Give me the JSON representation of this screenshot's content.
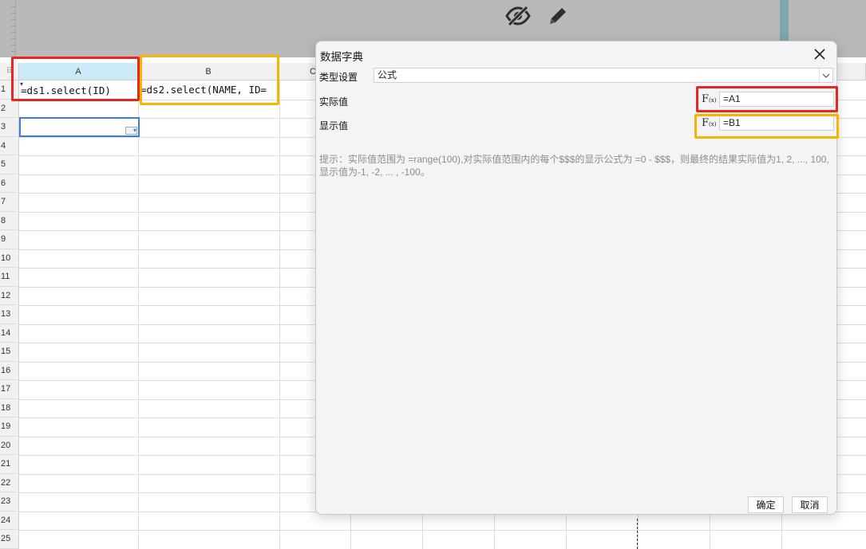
{
  "toolbar": {
    "icons": [
      "eye-off-icon",
      "pencil-icon"
    ]
  },
  "sheet": {
    "column_headers": [
      "A",
      "B",
      "C"
    ],
    "row_headers": [
      "1",
      "2",
      "3",
      "4",
      "5",
      "6",
      "7",
      "8",
      "9",
      "10",
      "11",
      "12",
      "13",
      "14",
      "15",
      "16",
      "17",
      "18",
      "19",
      "20",
      "21",
      "22",
      "23",
      "24",
      "25"
    ],
    "cells": {
      "A1": "=ds1.select(ID)",
      "B1": "=ds2.select(NAME, ID="
    },
    "active_cell": "A3",
    "highlight_colors": {
      "red": "#e8251f",
      "yellow": "#f7b500",
      "selection": "#3b7fd5"
    }
  },
  "dialog": {
    "title": "数据字典",
    "type_label": "类型设置",
    "type_value": "公式",
    "actual_label": "实际值",
    "actual_formula": "=A1",
    "display_label": "显示值",
    "display_formula": "=B1",
    "fx_label": "F",
    "fx_sub": "(x)",
    "hint": "提示：实际值范围为 =range(100),对实际值范围内的每个$$$的显示公式为 =0 - $$$，则最终的结果实际值为1, 2, ..., 100, 显示值为-1, -2, ... , -100。",
    "ok_label": "确定",
    "cancel_label": "取消"
  }
}
